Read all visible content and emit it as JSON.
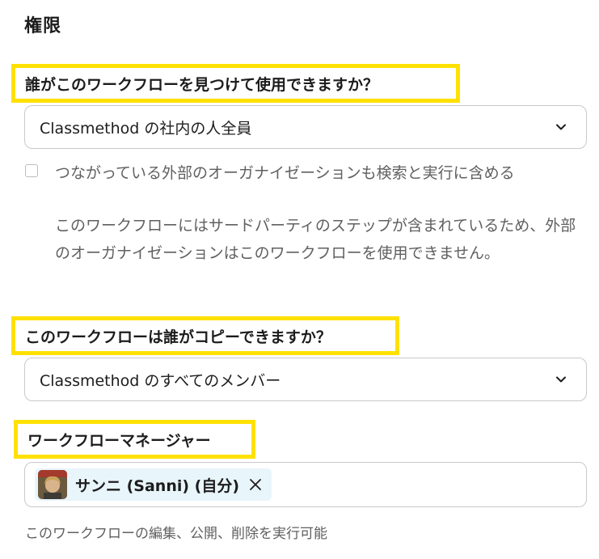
{
  "section_title": "権限",
  "usage": {
    "question": "誰がこのワークフローを見つけて使用できますか？",
    "selected": "Classmethod の社内の人全員"
  },
  "external": {
    "checkbox_label": "つながっている外部のオーガナイゼーションも検索と実行に含める",
    "help_text": "このワークフローにはサードパーティのステップが含まれているため、外部のオーガナイゼーションはこのワークフローを使用できません。",
    "checked": false
  },
  "copy": {
    "question": "このワークフローは誰がコピーできますか？",
    "selected": "Classmethod のすべてのメンバー"
  },
  "managers": {
    "label": "ワークフローマネージャー",
    "chip_name": "サンニ (Sanni) (自分)",
    "note": "このワークフローの編集、公開、削除を実行可能"
  },
  "colors": {
    "highlight": "#ffe100",
    "chip_bg": "#e8f5fa",
    "muted_text": "#616061"
  }
}
